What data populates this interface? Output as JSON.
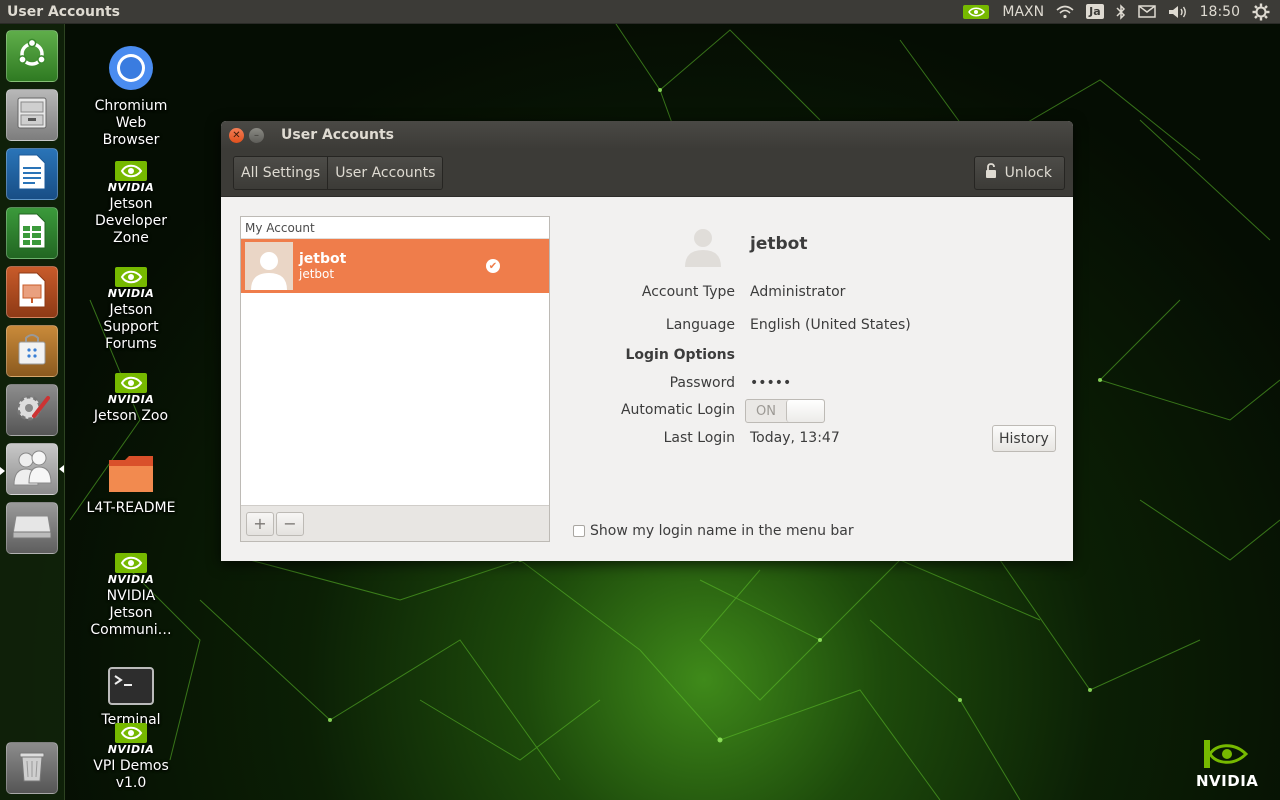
{
  "top_panel": {
    "title": "User Accounts",
    "power_mode": "MAXN",
    "keyboard_layout": "Ja",
    "clock": "18:50"
  },
  "launcher": {
    "items": [
      "dash-home",
      "files",
      "libreoffice-writer",
      "libreoffice-calc",
      "libreoffice-impress",
      "ubuntu-software",
      "system-settings",
      "user-accounts",
      "removable-drive",
      "trash"
    ]
  },
  "desktop": {
    "icons": [
      {
        "label": "Chromium Web Browser",
        "icon": "chromium-icon"
      },
      {
        "label": "Jetson Developer Zone",
        "icon": "nvidia-logo-icon",
        "logo_text": "NVIDIA"
      },
      {
        "label": "Jetson Support Forums",
        "icon": "nvidia-logo-icon",
        "logo_text": "NVIDIA"
      },
      {
        "label": "Jetson Zoo",
        "icon": "nvidia-logo-icon",
        "logo_text": "NVIDIA"
      },
      {
        "label": "L4T-README",
        "icon": "folder-icon"
      },
      {
        "label": "NVIDIA Jetson Communi…",
        "icon": "nvidia-logo-icon",
        "logo_text": "NVIDIA"
      },
      {
        "label": "Terminal",
        "icon": "terminal-icon"
      },
      {
        "label": "VPI Demos v1.0",
        "icon": "nvidia-logo-icon",
        "logo_text": "NVIDIA"
      }
    ],
    "corner_logo_text": "NVIDIA"
  },
  "window": {
    "title": "User Accounts",
    "toolbar": {
      "breadcrumbs": [
        "All Settings",
        "User Accounts"
      ],
      "unlock_label": "Unlock"
    },
    "account_list": {
      "header": "My Account",
      "accounts": [
        {
          "name": "jetbot",
          "username": "jetbot",
          "selected": true
        }
      ],
      "add_symbol": "+",
      "remove_symbol": "−"
    },
    "details": {
      "user_name": "jetbot",
      "account_type_label": "Account Type",
      "account_type_value": "Administrator",
      "language_label": "Language",
      "language_value": "English (United States)",
      "login_options_label": "Login Options",
      "password_label": "Password",
      "password_value": "•••••",
      "auto_login_label": "Automatic Login",
      "auto_login_toggle_text": "ON",
      "last_login_label": "Last Login",
      "last_login_value": "Today, 13:47",
      "history_label": "History",
      "show_login_name_label": "Show my login name in the menu bar",
      "show_login_name_checked": false
    }
  },
  "colors": {
    "selection": "#ef7d4b",
    "panel": "#3c3b37",
    "window_bg": "#f2f1f0",
    "nvidia_green": "#76b900"
  }
}
